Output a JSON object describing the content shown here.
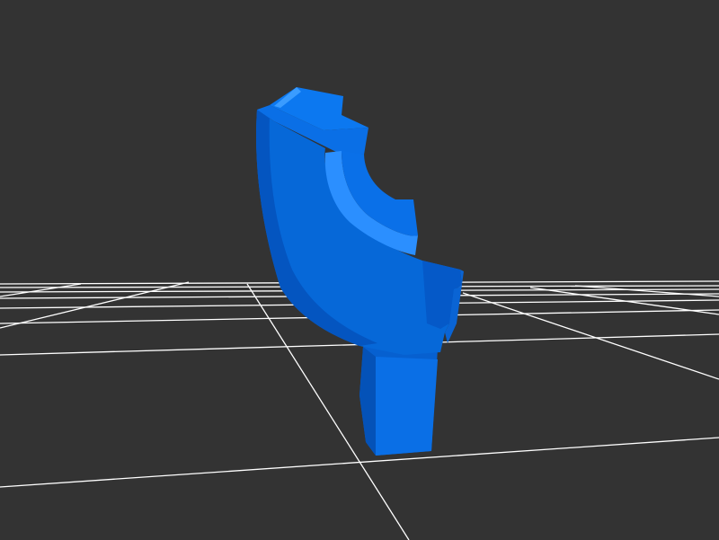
{
  "viewport": {
    "background_color": "#333333",
    "grid_color": "#ffffff",
    "model_color": "#0a6ad8"
  }
}
